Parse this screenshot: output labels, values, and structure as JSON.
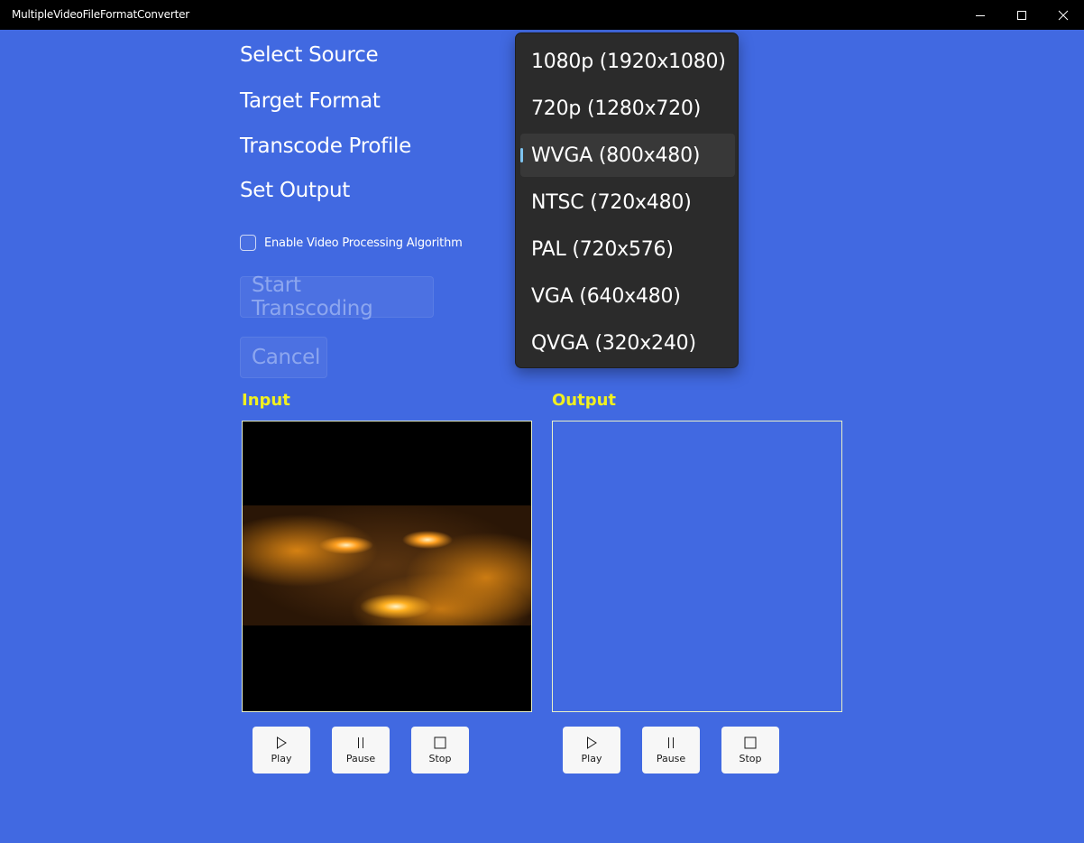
{
  "window": {
    "title": "MultipleVideoFileFormatConverter",
    "controls": {
      "minimize": "minimize-icon",
      "maximize": "maximize-icon",
      "close": "close-icon"
    }
  },
  "colors": {
    "background": "#4169e1",
    "titlebar": "#000000",
    "section_label": "#f0f020",
    "dropdown_bg": "#2b2b2b",
    "selection_indicator": "#7ec4f0"
  },
  "nav": {
    "items": [
      {
        "label": "Select Source"
      },
      {
        "label": "Target Format"
      },
      {
        "label": "Transcode Profile"
      },
      {
        "label": "Set Output"
      }
    ]
  },
  "options": {
    "enable_algorithm": {
      "label": "Enable Video Processing Algorithm",
      "checked": false
    }
  },
  "actions": {
    "start_label": "Start Transcoding",
    "cancel_label": "Cancel"
  },
  "profile_dropdown": {
    "selected": "WVGA (800x480)",
    "items": [
      {
        "label": "1080p (1920x1080)"
      },
      {
        "label": "720p (1280x720)"
      },
      {
        "label": "WVGA (800x480)"
      },
      {
        "label": "NTSC (720x480)"
      },
      {
        "label": "PAL (720x576)"
      },
      {
        "label": "VGA (640x480)"
      },
      {
        "label": "QVGA (320x240)"
      }
    ]
  },
  "input_panel": {
    "label": "Input",
    "controls": [
      {
        "label": "Play",
        "icon": "play-icon"
      },
      {
        "label": "Pause",
        "icon": "pause-icon"
      },
      {
        "label": "Stop",
        "icon": "stop-icon"
      }
    ]
  },
  "output_panel": {
    "label": "Output",
    "controls": [
      {
        "label": "Play",
        "icon": "play-icon"
      },
      {
        "label": "Pause",
        "icon": "pause-icon"
      },
      {
        "label": "Stop",
        "icon": "stop-icon"
      }
    ]
  }
}
